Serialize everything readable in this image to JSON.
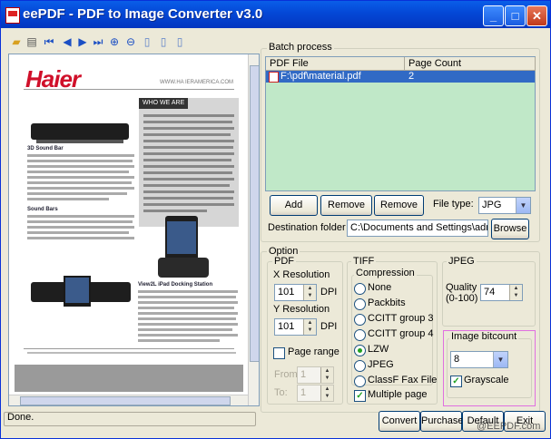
{
  "window": {
    "title": "eePDF - PDF to Image Converter v3.0",
    "minimize": "_",
    "maximize": "□",
    "close": "✕"
  },
  "preview": {
    "brand": "Haier",
    "url": "WWW.HA IERAMERICA.COM",
    "sidebar_heading": "WHO WE ARE",
    "section_1": "3D Sound Bar",
    "section_2": "Sound Bars",
    "section_3": "View2L iPad Docking Station"
  },
  "batch": {
    "group_label": "Batch process",
    "columns": [
      "PDF File",
      "Page Count"
    ],
    "rows": [
      {
        "file": "F:\\pdf\\material.pdf",
        "pages": "2"
      }
    ],
    "add_label": "Add",
    "remove_label": "Remove",
    "remove_all_label": "Remove all",
    "file_type_label": "File type:",
    "file_type_value": "JPG",
    "destination_label": "Destination folder",
    "destination_value": "C:\\Documents and Settings\\admin\\Desk",
    "browse_label": "Browse"
  },
  "option": {
    "group_label": "Option",
    "pdf": {
      "label": "PDF",
      "x_res_label": "X Resolution",
      "x_res_value": "101",
      "y_res_label": "Y Resolution",
      "y_res_value": "101",
      "dpi": "DPI",
      "page_range_label": "Page range",
      "from_label": "From:",
      "from_value": "1",
      "to_label": "To:",
      "to_value": "1"
    },
    "tiff": {
      "label": "TIFF",
      "compression_label": "Compression",
      "options": [
        "None",
        "Packbits",
        "CCITT group 3",
        "CCITT group 4",
        "LZW",
        "JPEG",
        "ClassF Fax File"
      ],
      "selected": "LZW",
      "multiple_page_label": "Multiple page"
    },
    "jpeg": {
      "label": "JPEG",
      "quality_label": "Quality",
      "quality_range": "(0-100)",
      "quality_value": "74"
    },
    "bitcount": {
      "label": "Image bitcount",
      "value": "8",
      "grayscale_label": "Grayscale"
    }
  },
  "footer": {
    "status": "Done.",
    "convert": "Convert",
    "purchase": "Purchase",
    "default": "Default",
    "exit": "Exit",
    "watermark": "@EEPDF.com"
  },
  "colors": {
    "title_bar": "#0447d6",
    "table_bg": "#c0e8c8",
    "selection": "#316ac5",
    "highlight_box": "#e070e0",
    "brand_red": "#d0102a"
  }
}
